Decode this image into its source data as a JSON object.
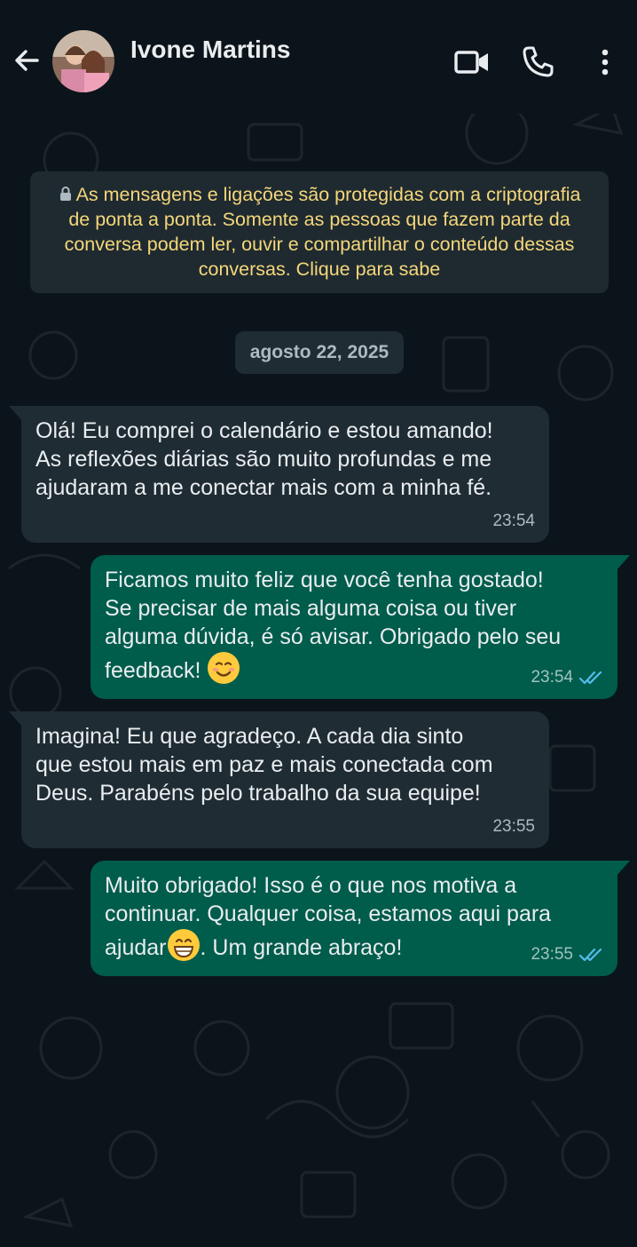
{
  "header": {
    "contact_name": "Ivone Martins",
    "icons": [
      "back-arrow-icon",
      "avatar",
      "video-call-icon",
      "phone-icon",
      "more-options-icon"
    ]
  },
  "encryption_notice": "As mensagens e ligações são protegidas com a criptografia de ponta a ponta. Somente as pessoas que fazem parte da conversa podem ler, ouvir e compartilhar o conteúdo dessas conversas. Clique para sabe",
  "date_divider": "agosto 22, 2025",
  "messages": [
    {
      "direction": "incoming",
      "text": "Olá! Eu comprei o calendário e estou amando!\nAs reflexões diárias são muito profundas e me\najudaram a me conectar mais com a minha fé.",
      "time": "23:54"
    },
    {
      "direction": "outgoing",
      "text": "Ficamos muito feliz que você tenha gostado!\nSe precisar de mais alguma coisa ou tiver\nalguma dúvida, é só avisar. Obrigado pelo seu\nfeedback! ",
      "emoji": "smiling-face-emoji",
      "time": "23:54",
      "status": "read"
    },
    {
      "direction": "incoming",
      "text": "Imagina! Eu que agradeço. A cada dia sinto\nque estou mais em paz e mais conectada com\nDeus. Parabéns pelo trabalho da sua equipe!",
      "time": "23:55"
    },
    {
      "direction": "outgoing",
      "text_before": "Muito obrigado! Isso é o que nos motiva a\ncontinuar. Qualquer coisa, estamos aqui para\najudar",
      "text_after": ". Um grande abraço!",
      "emoji": "grinning-face-emoji",
      "time": "23:55",
      "status": "read"
    }
  ],
  "colors": {
    "background": "#0b141a",
    "incoming_bubble": "#202c33",
    "outgoing_bubble": "#005c4b",
    "notice_text": "#f5d77b",
    "read_ticks": "#53bdeb"
  }
}
